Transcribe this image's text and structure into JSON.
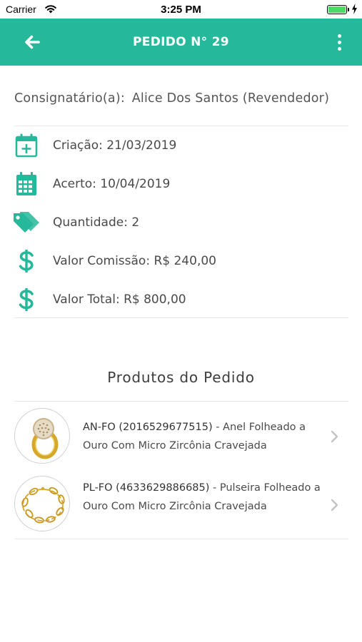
{
  "status_bar": {
    "carrier": "Carrier",
    "time": "3:25 PM"
  },
  "nav": {
    "title": "PEDIDO N° 29"
  },
  "consignee": {
    "label": "Consignatário(a):",
    "value": "Alice Dos Santos (Revendedor)"
  },
  "info": {
    "created": "Criação: 21/03/2019",
    "settlement": "Acerto: 10/04/2019",
    "quantity": "Quantidade: 2",
    "commission": "Valor Comissão: R$ 240,00",
    "total": "Valor Total: R$ 800,00"
  },
  "products_section": {
    "title": "Produtos do Pedido"
  },
  "products": [
    {
      "code": "AN-FO (2016529677515)",
      "description": " - Anel Folheado a Ouro Com Micro Zircônia Cravejada"
    },
    {
      "code": "PL-FO (4633629886685)",
      "description": " - Pulseira Folheado a Ouro Com Micro Zircônia Cravejada"
    }
  ],
  "colors": {
    "accent": "#25b89a",
    "text": "#4a4a4a",
    "divider": "#e8e8e8",
    "battery": "#4cd964"
  },
  "icons": [
    "wifi-icon",
    "battery-icon",
    "back-arrow-icon",
    "more-vertical-icon",
    "calendar-plus-icon",
    "calendar-grid-icon",
    "tags-icon",
    "dollar-icon",
    "ring-image",
    "bracelet-image",
    "chevron-right-icon"
  ]
}
